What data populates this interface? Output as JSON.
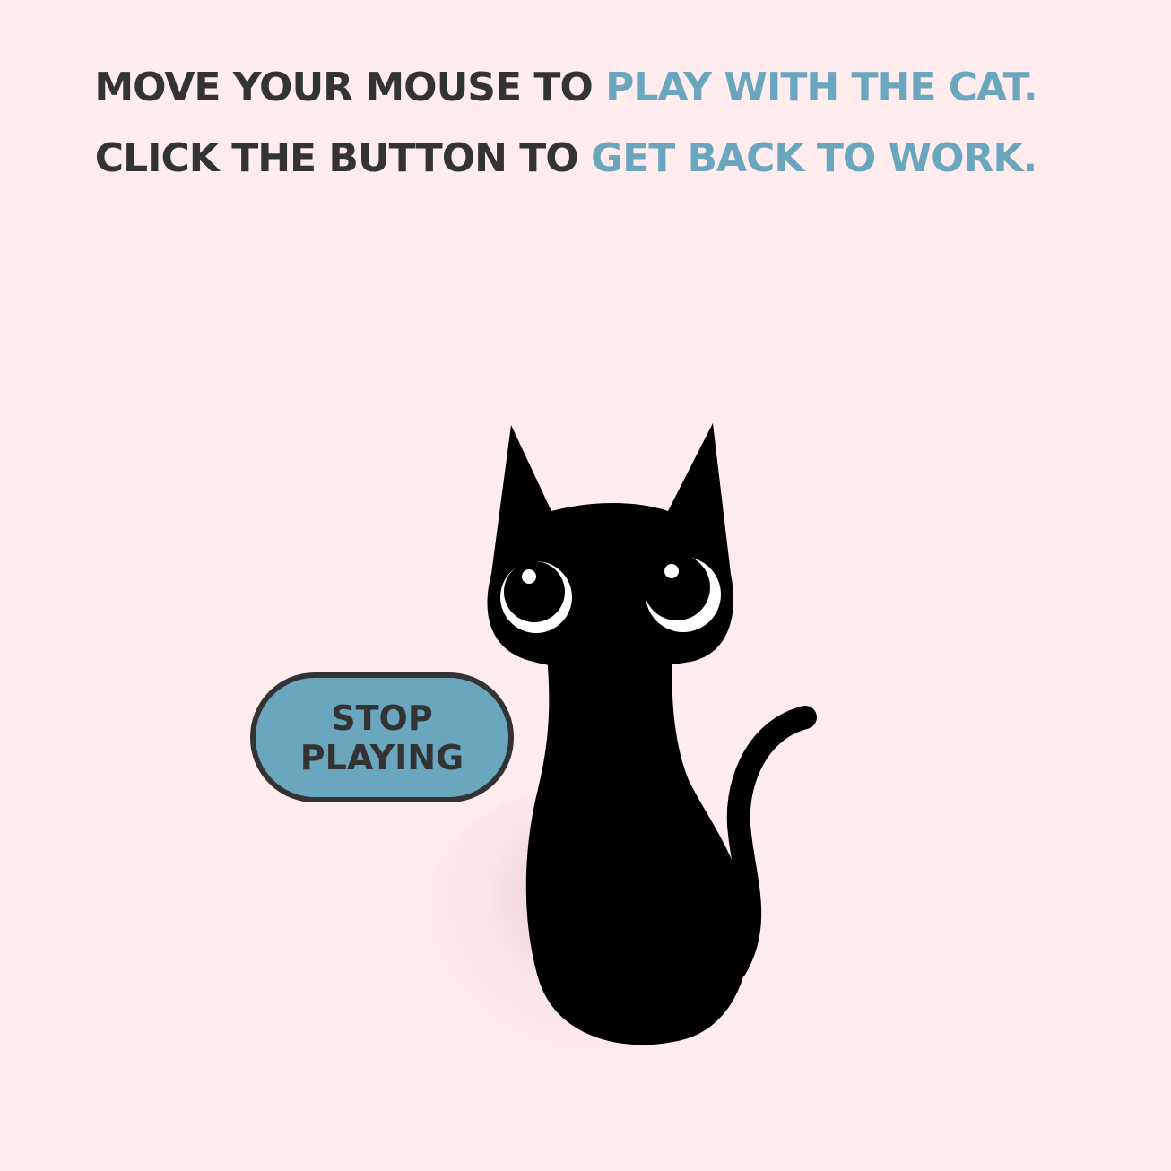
{
  "instructions": {
    "line1_prefix": "Move your mouse to",
    "line1_accent": "play with the cat.",
    "line2_prefix": "Click the button to",
    "line2_accent": "get back to work."
  },
  "button": {
    "line1": "Stop",
    "line2": "Playing"
  },
  "colors": {
    "background": "#ffecee",
    "text": "#333333",
    "accent": "#6aa6bd",
    "cat": "#000000"
  }
}
